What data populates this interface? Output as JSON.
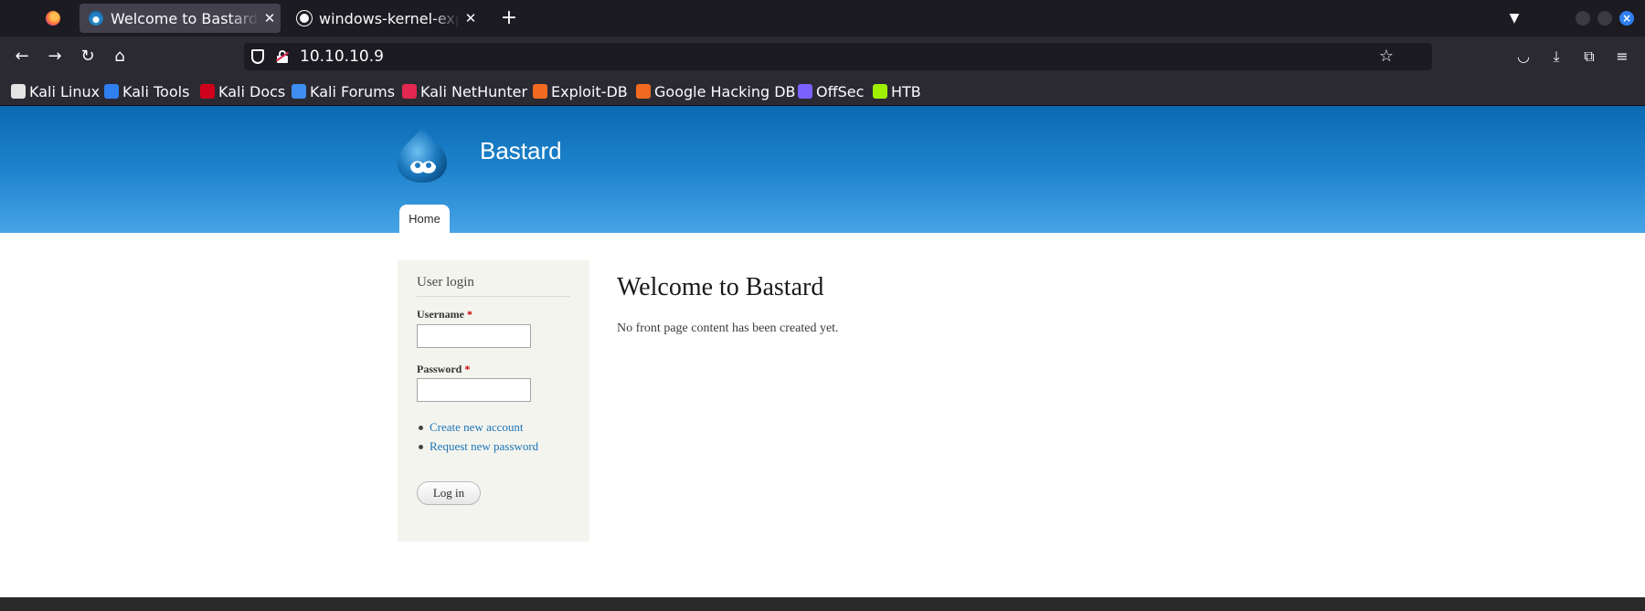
{
  "browser": {
    "tabs": [
      {
        "title": "Welcome to Bastard | Bastard",
        "active": true,
        "favicon": "drupal-icon"
      },
      {
        "title": "windows-kernel-exploits",
        "active": false,
        "favicon": "github-icon"
      }
    ],
    "url": "10.10.10.9",
    "bookmarks": [
      {
        "label": "Kali Linux",
        "icon": "kali-icon",
        "color": "#e4e4e4"
      },
      {
        "label": "Kali Tools",
        "icon": "kali-tools-icon",
        "color": "#2f7ff0"
      },
      {
        "label": "Kali Docs",
        "icon": "kali-docs-icon",
        "color": "#d0021b"
      },
      {
        "label": "Kali Forums",
        "icon": "kali-forums-icon",
        "color": "#3d8ef0"
      },
      {
        "label": "Kali NetHunter",
        "icon": "nethunter-icon",
        "color": "#e22850"
      },
      {
        "label": "Exploit-DB",
        "icon": "exploitdb-icon",
        "color": "#f26a21"
      },
      {
        "label": "Google Hacking DB",
        "icon": "ghdb-icon",
        "color": "#f26a21"
      },
      {
        "label": "OffSec",
        "icon": "offsec-icon",
        "color": "#7b61ff"
      },
      {
        "label": "HTB",
        "icon": "htb-icon",
        "color": "#9fef00"
      }
    ]
  },
  "site": {
    "name": "Bastard",
    "nav": {
      "home_label": "Home"
    }
  },
  "login_block": {
    "title": "User login",
    "username_label": "Username",
    "password_label": "Password",
    "required_marker": "*",
    "username_value": "",
    "password_value": "",
    "links": [
      "Create new account",
      "Request new password"
    ],
    "submit_label": "Log in"
  },
  "main": {
    "title": "Welcome to Bastard",
    "content": "No front page content has been created yet."
  },
  "colors": {
    "header_top": "#0a6ab1",
    "header_bottom": "#47a4e6",
    "link": "#1a73b5",
    "required": "#cc0000"
  }
}
